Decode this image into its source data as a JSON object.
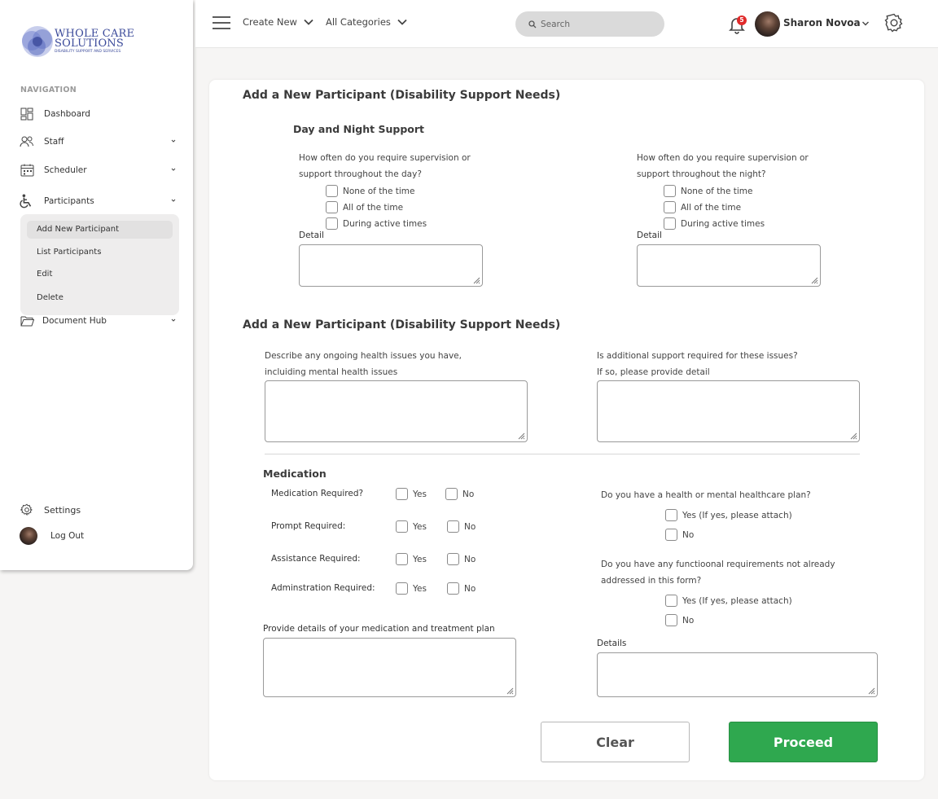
{
  "brand": {
    "line1": "WHOLE CARE",
    "line2": "SOLUTIONS",
    "tagline": "DISABILITY SUPPORT AND SERVICES",
    "color": "#3b4a9a"
  },
  "sidebar": {
    "heading": "NAVIGATION",
    "items": [
      {
        "label": "Dashboard",
        "icon": "dashboard-icon"
      },
      {
        "label": "Staff",
        "icon": "users-icon"
      },
      {
        "label": "Scheduler",
        "icon": "calendar-icon"
      },
      {
        "label": "Participants",
        "icon": "wheelchair-icon"
      },
      {
        "label": "Document Hub",
        "icon": "folder-icon"
      }
    ],
    "submenu": [
      "Add New Participant",
      "List Participants",
      "Edit",
      "Delete"
    ],
    "footer": {
      "settings": "Settings",
      "logout": "Log Out"
    }
  },
  "topbar": {
    "create_new": "Create New",
    "all_categories": "All Categories",
    "search_placeholder": "Search",
    "notification_count": "5",
    "user_name": "Sharon Novoa"
  },
  "form": {
    "section1_title": "Add a New Participant (Disability Support Needs)",
    "day_night_title": "Day and Night Support",
    "day": {
      "question_line1": "How often do you require supervision or",
      "question_line2": "support throughout the day?",
      "options": [
        "None of the time",
        "All of the time",
        "During active times"
      ],
      "detail_label": "Detail"
    },
    "night": {
      "question_line1": "How often do you require supervision or",
      "question_line2": "support throughout the night?",
      "options": [
        "None of the time",
        "All of the time",
        "During active times"
      ],
      "detail_label": "Detail"
    },
    "section2_title": "Add a New Participant (Disability Support Needs)",
    "health": {
      "question_line1": "Describe any ongoing health issues you have,",
      "question_line2": "incluiding mental health issues"
    },
    "support": {
      "question_line1": "Is additional support required for these issues?",
      "question_line2": "If so, please provide detail"
    },
    "medication": {
      "title": "Medication",
      "rows": [
        {
          "label": "Medication Required?",
          "yes": "Yes",
          "no": "No"
        },
        {
          "label": "Prompt Required:",
          "yes": "Yes",
          "no": "No"
        },
        {
          "label": "Assistance Required:",
          "yes": "Yes",
          "no": "No"
        },
        {
          "label": "Adminstration Required:",
          "yes": "Yes",
          "no": "No"
        }
      ],
      "plan_label": "Provide details of your medication and treatment plan"
    },
    "healthcare_plan": {
      "question": "Do you have a health or mental  healthcare plan?",
      "yes": "Yes (If yes, please attach)",
      "no": "No"
    },
    "functional": {
      "question_line1": "Do you have any functioonal requirements not already",
      "question_line2": "addressed in this form?",
      "yes": "Yes (If yes, please attach)",
      "no": "No"
    },
    "details_label": "Details",
    "clear_label": "Clear",
    "proceed_label": "Proceed"
  },
  "colors": {
    "proceed": "#2fa84f",
    "badge": "#e02b2b"
  }
}
